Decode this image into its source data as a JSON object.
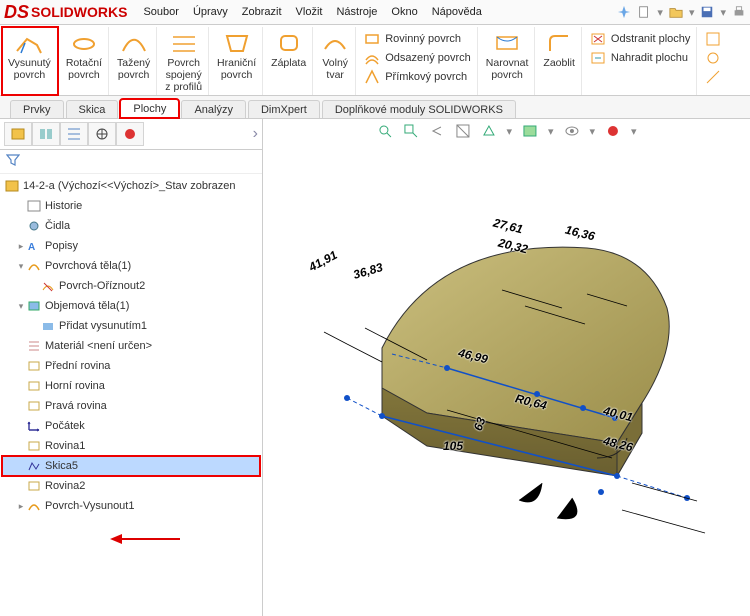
{
  "app": {
    "brand_mark": "DS",
    "brand_name": "SOLIDWORKS"
  },
  "menu": [
    "Soubor",
    "Úpravy",
    "Zobrazit",
    "Vložit",
    "Nástroje",
    "Okno",
    "Nápověda"
  ],
  "ribbon_large": [
    {
      "key": "vysunuty",
      "label_l1": "Vysunutý",
      "label_l2": "povrch",
      "highlighted": true
    },
    {
      "key": "rotacni",
      "label_l1": "Rotační",
      "label_l2": "povrch"
    },
    {
      "key": "tazeny",
      "label_l1": "Tažený",
      "label_l2": "povrch"
    },
    {
      "key": "spojeny",
      "label_l1": "Povrch",
      "label_l2": "spojený",
      "label_l3": "z profilů"
    },
    {
      "key": "hranicni",
      "label_l1": "Hraniční",
      "label_l2": "povrch"
    },
    {
      "key": "zaplata",
      "label_l1": "Záplata",
      "label_l2": ""
    },
    {
      "key": "volny",
      "label_l1": "Volný",
      "label_l2": "tvar"
    }
  ],
  "ribbon_col_a": [
    {
      "label": "Rovinný povrch"
    },
    {
      "label": "Odsazený povrch"
    },
    {
      "label": "Přímkový povrch"
    }
  ],
  "ribbon_small": [
    {
      "key": "narovnat",
      "label_l1": "Narovnat",
      "label_l2": "povrch"
    },
    {
      "key": "zaoblit",
      "label_l1": "Zaoblit",
      "label_l2": ""
    }
  ],
  "ribbon_col_b": [
    {
      "label": "Odstranit plochy"
    },
    {
      "label": "Nahradit plochu"
    }
  ],
  "tabs": [
    {
      "label": "Prvky"
    },
    {
      "label": "Skica"
    },
    {
      "label": "Plochy",
      "active": true
    },
    {
      "label": "Analýzy"
    },
    {
      "label": "DimXpert"
    },
    {
      "label": "Doplňkové moduly SOLIDWORKS"
    }
  ],
  "tree": {
    "root": "14-2-a  (Výchozí<<Výchozí>_Stav zobrazen",
    "items": [
      {
        "label": "Historie"
      },
      {
        "label": "Čidla"
      },
      {
        "label": "Popisy",
        "expandable": true
      },
      {
        "label": "Povrchová těla(1)",
        "expandable": true,
        "expanded": true,
        "children": [
          {
            "label": "Povrch-Oříznout2"
          }
        ]
      },
      {
        "label": "Objemová těla(1)",
        "expandable": true,
        "expanded": true,
        "children": [
          {
            "label": "Přidat vysunutím1"
          }
        ]
      },
      {
        "label": "Materiál <není určen>"
      },
      {
        "label": "Přední rovina"
      },
      {
        "label": "Horní rovina"
      },
      {
        "label": "Pravá rovina"
      },
      {
        "label": "Počátek"
      },
      {
        "label": "Rovina1"
      },
      {
        "label": "Skica5",
        "selected": true,
        "hl": true
      },
      {
        "label": "Rovina2"
      },
      {
        "label": "Povrch-Vysunout1",
        "expandable": true
      }
    ]
  },
  "dimensions": {
    "d1": "41,91",
    "d2": "36,83",
    "d3": "27,61",
    "d4": "20,32",
    "d5": "16,36",
    "d6": "46,99",
    "d7": "63",
    "d8": "R0,64",
    "d9": "105",
    "d10": "40,01",
    "d11": "48,26"
  }
}
